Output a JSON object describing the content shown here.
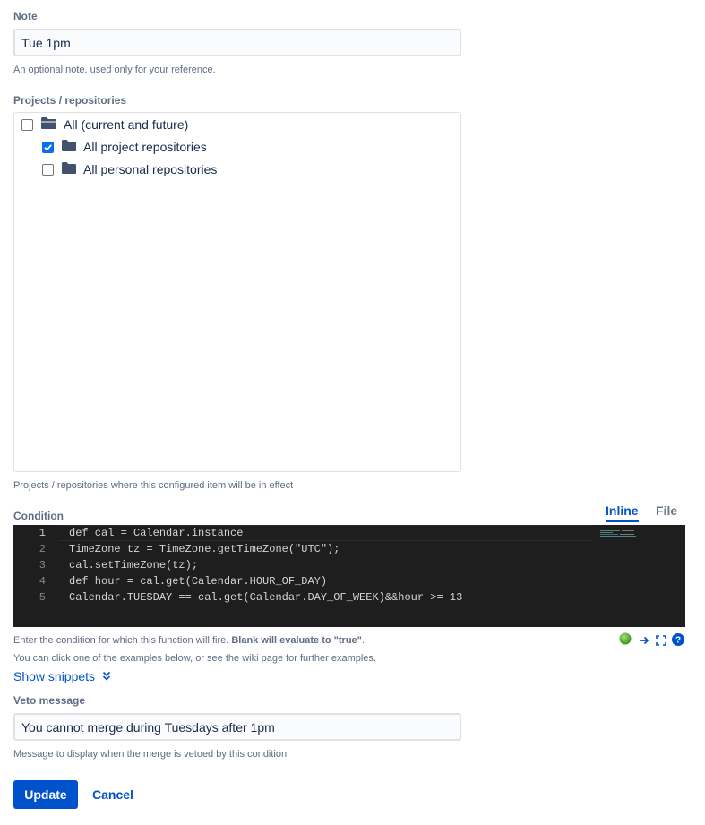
{
  "note": {
    "label": "Note",
    "value": "Tue 1pm",
    "help": "An optional note, used only for your reference."
  },
  "projects": {
    "label": "Projects / repositories",
    "items": [
      {
        "label": "All (current and future)",
        "checked": false,
        "icon": "folder-open-icon"
      },
      {
        "label": "All project repositories",
        "checked": true,
        "icon": "folder-icon"
      },
      {
        "label": "All personal repositories",
        "checked": false,
        "icon": "folder-icon"
      }
    ],
    "help": "Projects / repositories where this configured item will be in effect"
  },
  "condition": {
    "label": "Condition",
    "tabs": [
      {
        "label": "Inline",
        "active": true
      },
      {
        "label": "File",
        "active": false
      }
    ],
    "line_numbers": [
      "1",
      "2",
      "3",
      "4",
      "5"
    ],
    "code_lines": [
      "def cal = Calendar.instance",
      "TimeZone tz = TimeZone.getTimeZone(\"UTC\");",
      "cal.setTimeZone(tz);",
      "def hour = cal.get(Calendar.HOUR_OF_DAY)",
      "Calendar.TUESDAY == cal.get(Calendar.DAY_OF_WEEK)&&hour >= 13"
    ],
    "help_prefix": "Enter the condition for which this function will fire. ",
    "help_bold": "Blank will evaluate to \"true\"",
    "help_suffix": ".",
    "examples_help": "You can click one of the examples below, or see the wiki page for further examples.",
    "show_snippets": "Show snippets",
    "status_color": "#5cb85c",
    "icons": [
      "status-ok-icon",
      "arrow-right-icon",
      "fullscreen-icon",
      "help-icon"
    ]
  },
  "veto": {
    "label": "Veto message",
    "value": "You cannot merge during Tuesdays after 1pm",
    "help": "Message to display when the merge is vetoed by this condition"
  },
  "actions": {
    "update": "Update",
    "cancel": "Cancel"
  },
  "colors": {
    "accent": "#0052cc",
    "editor_bg": "#1e1e1e",
    "checkbox_checked": "#0b6ef2"
  }
}
